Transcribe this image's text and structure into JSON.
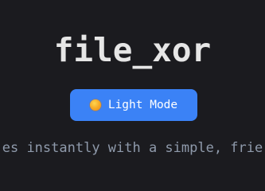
{
  "header": {
    "title": "file_xor"
  },
  "theme_toggle": {
    "icon": "sun-icon",
    "label": "Light Mode"
  },
  "tagline": {
    "text": "es instantly with a simple, frie"
  },
  "colors": {
    "background": "#1b1b1f",
    "title": "#e6e6e6",
    "button_bg": "#3b82f6",
    "button_text": "#ffffff",
    "tagline": "#8f9aab"
  }
}
